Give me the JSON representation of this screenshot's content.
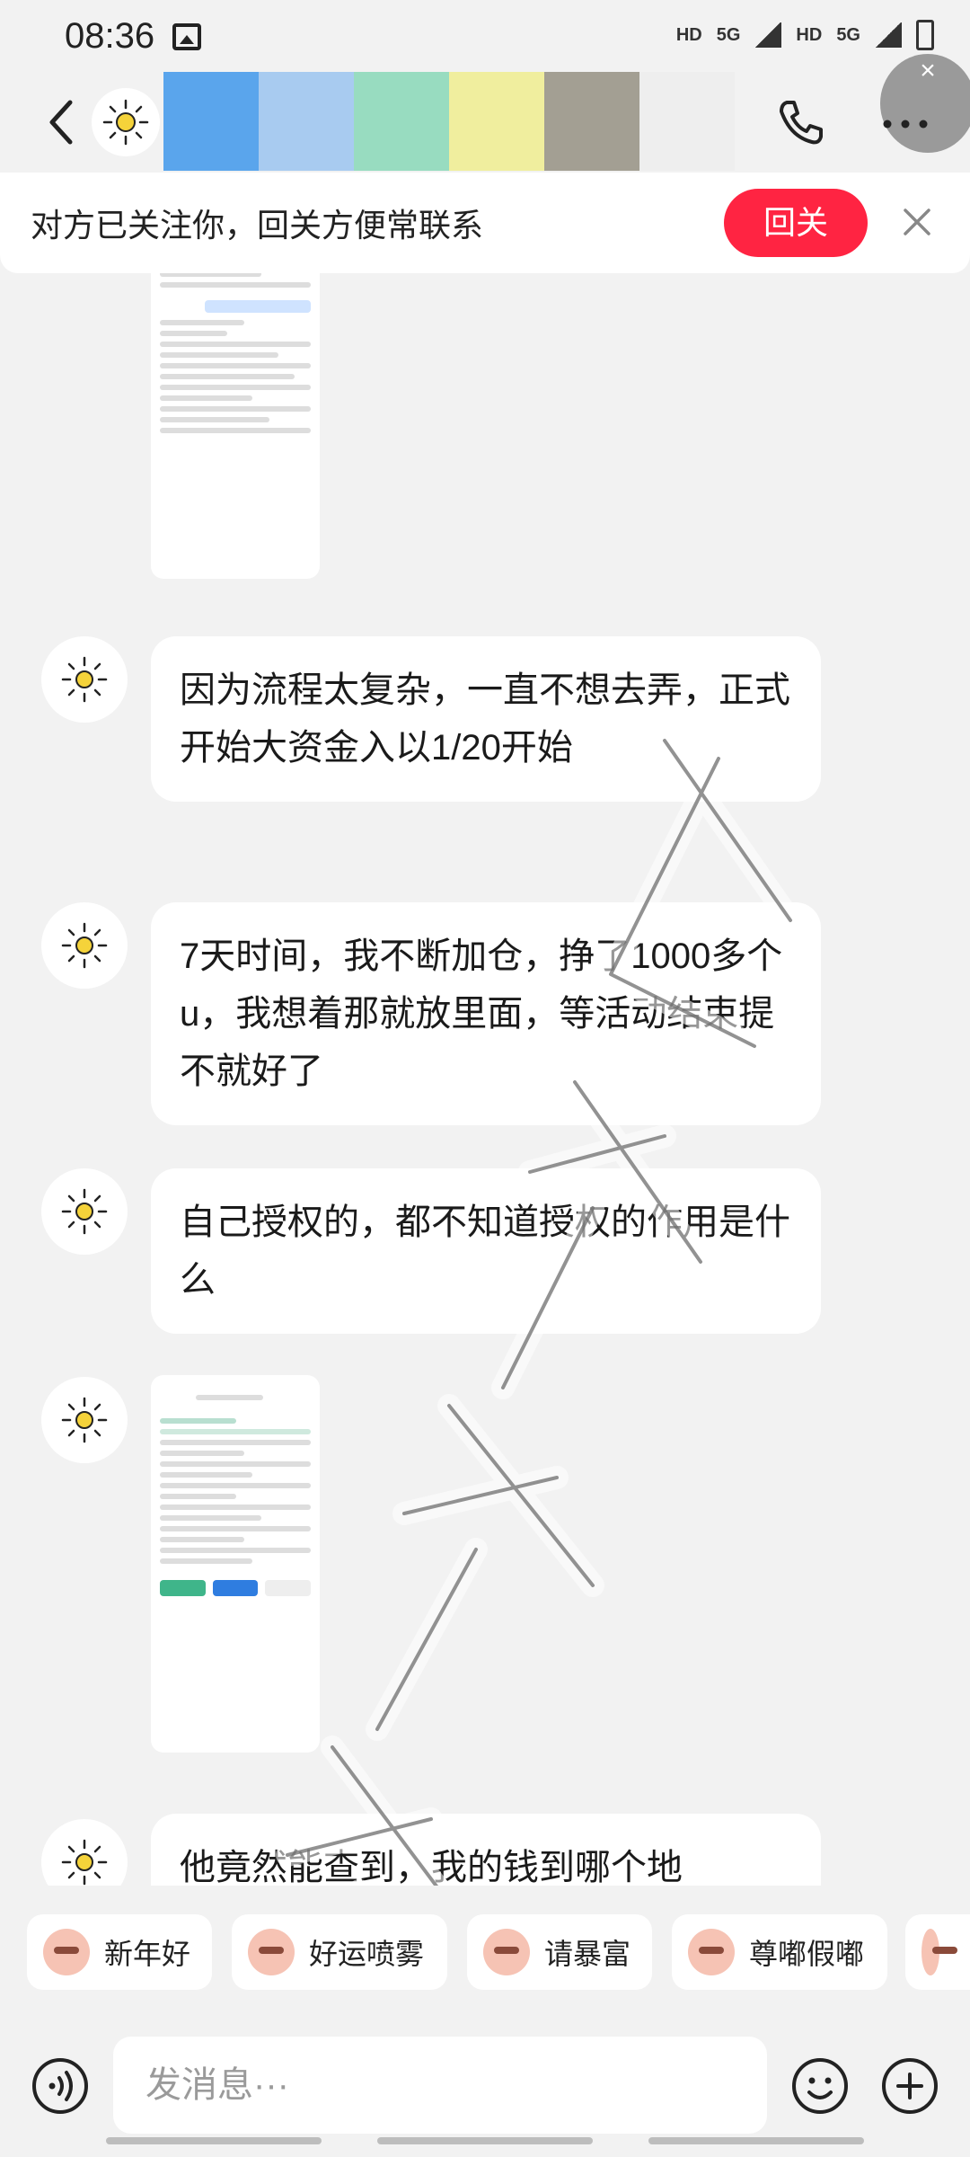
{
  "status_bar": {
    "time": "08:36",
    "indicators": [
      "HD",
      "5G",
      "HD",
      "5G"
    ]
  },
  "header": {
    "strip_colors": [
      "#5aa5ec",
      "#a8cbf0",
      "#98dcc0",
      "#f0ee9e",
      "#a39f93",
      "#eeeeee"
    ],
    "strip_close": "×"
  },
  "follow_banner": {
    "text": "对方已关注你，回关方便常联系",
    "button": "回关"
  },
  "messages": [
    {
      "type": "image"
    },
    {
      "type": "text",
      "text": "因为流程太复杂，一直不想去弄，正式开始大资金入以1/20开始"
    },
    {
      "type": "text",
      "text": "7天时间，我不断加仓，挣了1000多个u，我想着那就放里面，等活动结束提不就好了"
    },
    {
      "type": "text",
      "text": "自己授权的，都不知道授权的作用是什么"
    },
    {
      "type": "image"
    },
    {
      "type": "text",
      "text": "他竟然能查到，我的钱到哪个地"
    }
  ],
  "quick_replies": [
    "新年好",
    "好运喷雾",
    "请暴富",
    "尊嘟假嘟"
  ],
  "input": {
    "placeholder": "发消息···"
  },
  "colors": {
    "accent": "#ff2442",
    "background": "#f2f2f2",
    "bubble": "#ffffff"
  }
}
